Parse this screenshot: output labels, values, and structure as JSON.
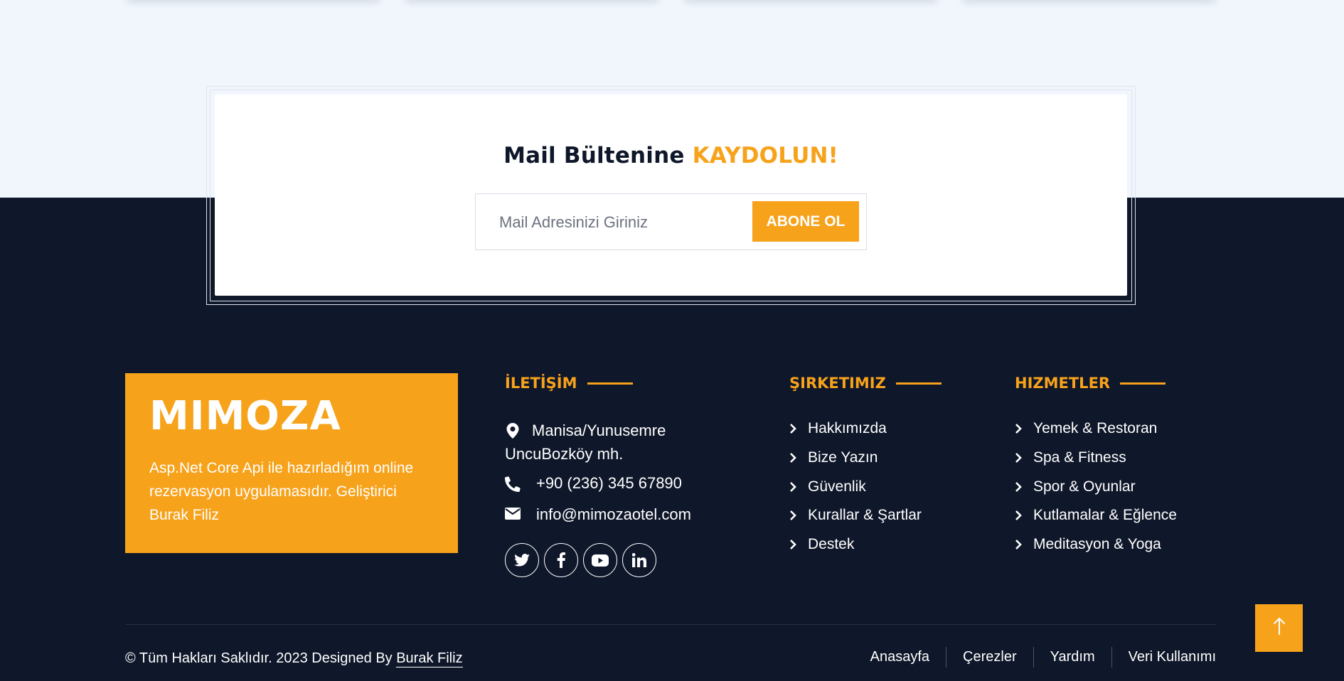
{
  "newsletter": {
    "title_main": "Mail Bültenine",
    "title_accent": "KAYDOLUN!",
    "email_placeholder": "Mail Adresinizi Giriniz",
    "email_value": "",
    "subscribe_label": "ABONE OL"
  },
  "brand": {
    "logo": "MIMOZA",
    "description": "Asp.Net Core Api ile hazırladığım online rezervasyon uygulamasıdır. Geliştirici Burak Filiz"
  },
  "contact": {
    "title": "İLETİŞİM",
    "address": "Manisa/Yunusemre UncuBozköy mh.",
    "phone": "+90 (236) 345 67890",
    "email": "info@mimozaotel.com",
    "socials": [
      "twitter-icon",
      "facebook-icon",
      "youtube-icon",
      "linkedin-icon"
    ]
  },
  "company": {
    "title": "ŞIRKETIMIZ",
    "items": [
      "Hakkımızda",
      "Bize Yazın",
      "Güvenlik",
      "Kurallar & Şartlar",
      "Destek"
    ]
  },
  "services": {
    "title": "HIZMETLER",
    "items": [
      "Yemek & Restoran",
      "Spa & Fitness",
      "Spor & Oyunlar",
      "Kutlamalar & Eğlence",
      "Meditasyon & Yoga"
    ]
  },
  "footer": {
    "copyright": "© Tüm Hakları Saklıdır. 2023 Designed By",
    "author": "Burak Filiz",
    "links": [
      "Anasayfa",
      "Çerezler",
      "Yardım",
      "Veri Kullanımı"
    ]
  },
  "colors": {
    "accent": "#f7a21b",
    "dark": "#0f172a",
    "light_band": "#f1f6fd"
  }
}
